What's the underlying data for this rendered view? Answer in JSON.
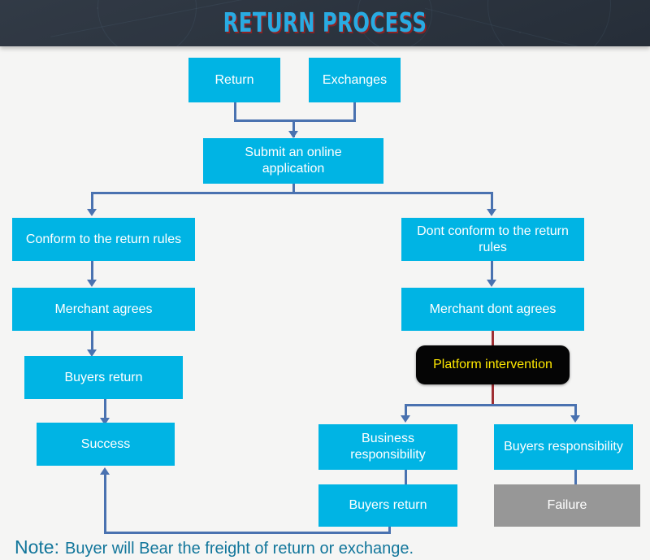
{
  "header": {
    "title": "RETURN PROCESS",
    "background_color": "#2b3440",
    "title_color": "#29abe2",
    "title_shadow_color": "#a01e1e"
  },
  "theme": {
    "page_background": "#f5f5f4",
    "node_blue": "#00b4e4",
    "node_black": "#050505",
    "node_black_text": "#ffe800",
    "node_grey": "#979797",
    "connector_blue": "#4a72b0",
    "connector_red": "#9e2f33",
    "note_color": "#12769b"
  },
  "nodes": {
    "return": "Return",
    "exchanges": "Exchanges",
    "submit": "Submit an online application",
    "conform": "Conform to the return rules",
    "merchant_agrees": "Merchant agrees",
    "buyers_return_left": "Buyers return",
    "success": "Success",
    "dont_conform": "Dont conform to the return rules",
    "merchant_dont_agrees": "Merchant dont agrees",
    "platform_intervention": "Platform intervention",
    "business_responsibility": "Business responsibility",
    "buyers_responsibility": "Buyers responsibility",
    "buyers_return_right": "Buyers return",
    "failure": "Failure"
  },
  "note": {
    "label": "Note:",
    "text": "Buyer will Bear the freight of return or exchange."
  }
}
